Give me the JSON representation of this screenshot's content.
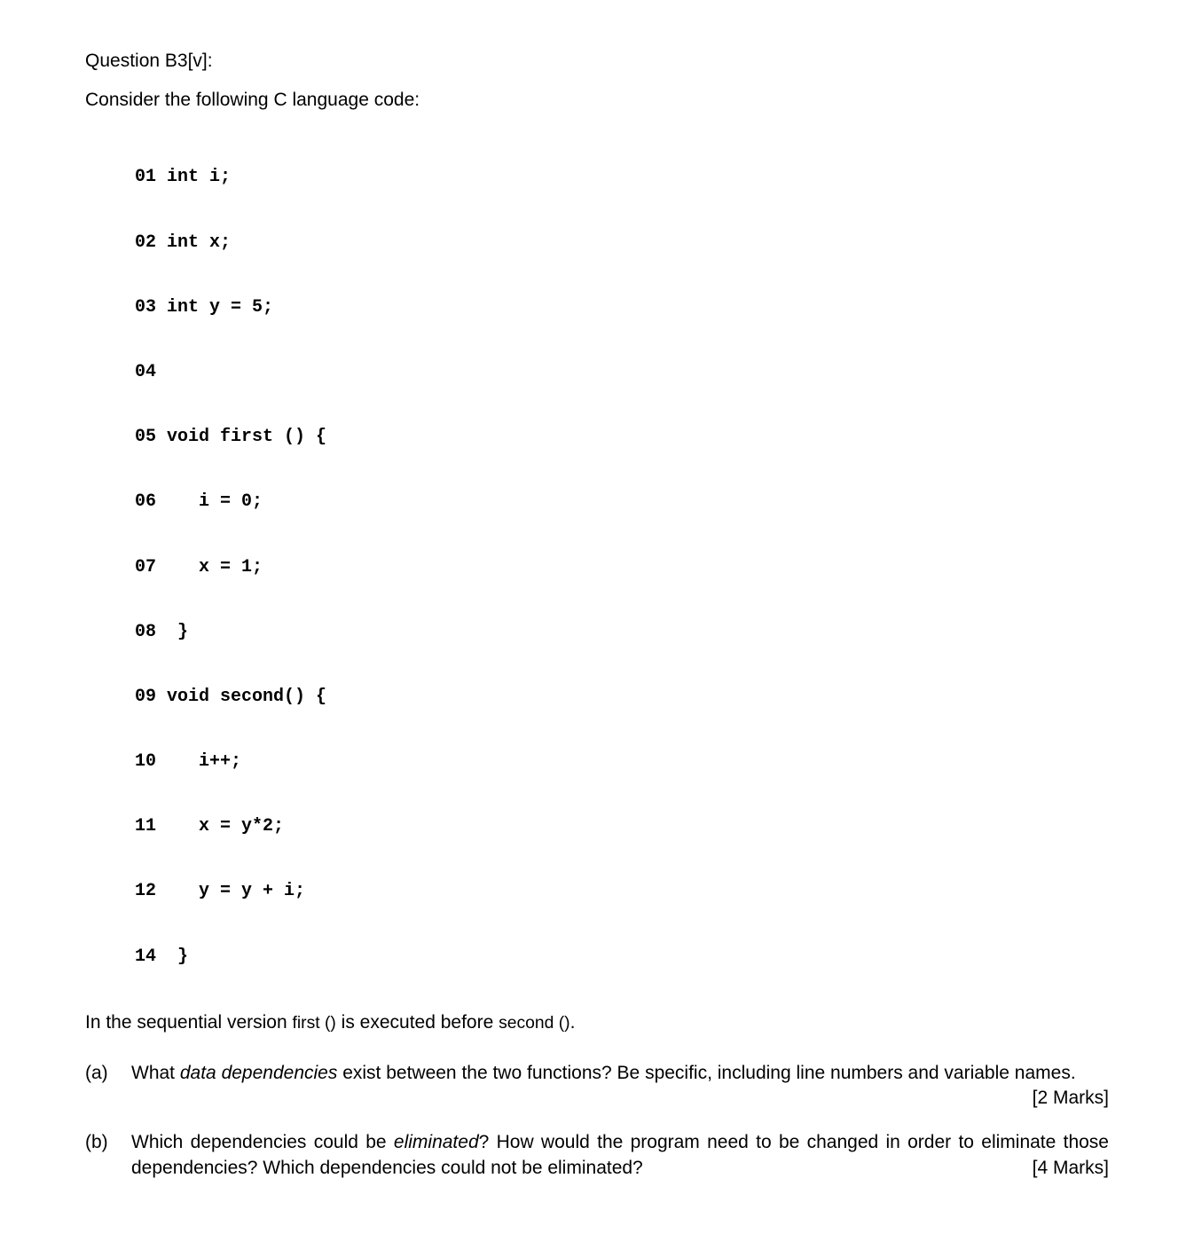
{
  "question_title": "Question B3[v]:",
  "intro": "Consider the following C language code:",
  "code": [
    {
      "ln": "01",
      "text": "int i;"
    },
    {
      "ln": "02",
      "text": "int x;"
    },
    {
      "ln": "03",
      "text": "int y = 5;"
    },
    {
      "ln": "04",
      "text": ""
    },
    {
      "ln": "05",
      "text": "void first () {"
    },
    {
      "ln": "06",
      "text": "   i = 0;"
    },
    {
      "ln": "07",
      "text": "   x = 1;"
    },
    {
      "ln": "08",
      "text": " }"
    },
    {
      "ln": "09",
      "text": "void second() {"
    },
    {
      "ln": "10",
      "text": "   i++;"
    },
    {
      "ln": "11",
      "text": "   x = y*2;"
    },
    {
      "ln": "12",
      "text": "   y = y + i;"
    },
    {
      "ln": "14",
      "text": " }"
    }
  ],
  "sequential_pre": "In the sequential version ",
  "sequential_first": "first ()",
  "sequential_mid": "  is executed before ",
  "sequential_second": "second ()",
  "sequential_post": ".",
  "part_a": {
    "label": "(a)",
    "pre": "What ",
    "em": "data dependencies",
    "post1": " exist between the two functions? Be specific, including line numbers and variable names.",
    "marks": "[2 Marks]"
  },
  "part_b": {
    "label": "(b)",
    "pre": "Which dependencies could be ",
    "em": "eliminated",
    "post1": "? How would the program need to be changed in order to eliminate those dependencies? Which dependencies could not be eliminated?",
    "marks": "[4 Marks]"
  }
}
